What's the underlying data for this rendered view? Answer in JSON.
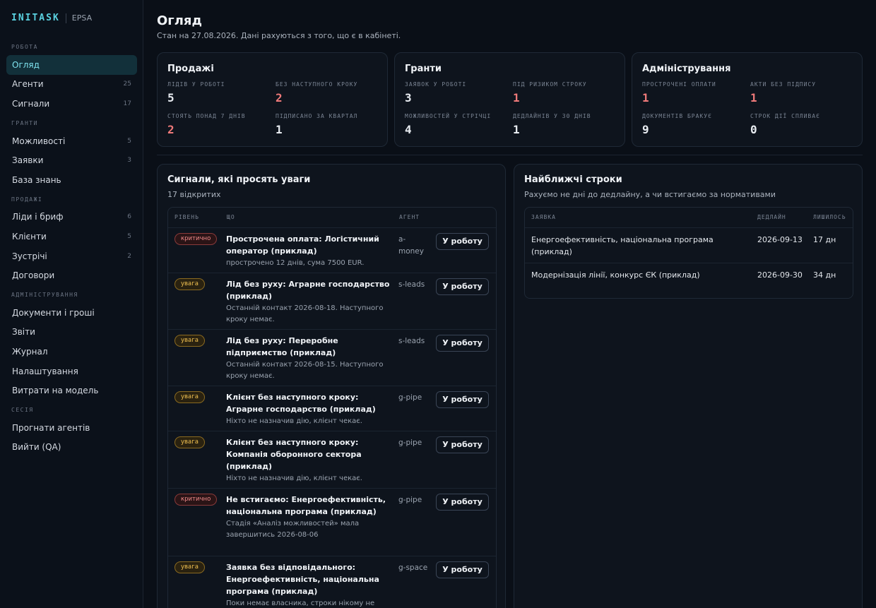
{
  "brand": {
    "logo": "INITASK",
    "sub": "EPSA"
  },
  "nav": {
    "sections": [
      {
        "title": "РОБОТА",
        "items": [
          {
            "label": "Огляд",
            "count": ""
          },
          {
            "label": "Агенти",
            "count": "25"
          },
          {
            "label": "Сигнали",
            "count": "17"
          }
        ]
      },
      {
        "title": "ГРАНТИ",
        "items": [
          {
            "label": "Можливості",
            "count": "5"
          },
          {
            "label": "Заявки",
            "count": "3"
          },
          {
            "label": "База знань",
            "count": ""
          }
        ]
      },
      {
        "title": "ПРОДАЖІ",
        "items": [
          {
            "label": "Ліди і бриф",
            "count": "6"
          },
          {
            "label": "Клієнти",
            "count": "5"
          },
          {
            "label": "Зустрічі",
            "count": "2"
          },
          {
            "label": "Договори",
            "count": ""
          }
        ]
      },
      {
        "title": "АДМІНІСТРУВАННЯ",
        "items": [
          {
            "label": "Документи і гроші",
            "count": ""
          },
          {
            "label": "Звіти",
            "count": ""
          },
          {
            "label": "Журнал",
            "count": ""
          },
          {
            "label": "Налаштування",
            "count": ""
          },
          {
            "label": "Витрати на модель",
            "count": ""
          }
        ]
      },
      {
        "title": "СЕСІЯ",
        "items": [
          {
            "label": "Прогнати агентів",
            "count": ""
          },
          {
            "label": "Вийти (QA)",
            "count": ""
          }
        ]
      }
    ]
  },
  "page": {
    "title": "Огляд",
    "subtitle": "Стан на 27.08.2026. Дані рахуються з того, що є в кабінеті."
  },
  "summary": {
    "sales": {
      "title": "Продажі",
      "stats": [
        {
          "label": "ЛІДІВ У РОБОТІ",
          "value": "5",
          "alert": false
        },
        {
          "label": "БЕЗ НАСТУПНОГО КРОКУ",
          "value": "2",
          "alert": true
        },
        {
          "label": "СТОЯТЬ ПОНАД 7 ДНІВ",
          "value": "2",
          "alert": true
        },
        {
          "label": "ПІДПИСАНО ЗА КВАРТАЛ",
          "value": "1",
          "alert": false
        }
      ]
    },
    "grants": {
      "title": "Гранти",
      "stats": [
        {
          "label": "ЗАЯВОК У РОБОТІ",
          "value": "3",
          "alert": false
        },
        {
          "label": "ПІД РИЗИКОМ СТРОКУ",
          "value": "1",
          "alert": true
        },
        {
          "label": "МОЖЛИВОСТЕЙ У СТРІЧЦІ",
          "value": "4",
          "alert": false
        },
        {
          "label": "ДЕДЛАЙНІВ У 30 ДНІВ",
          "value": "1",
          "alert": false
        }
      ]
    },
    "admin": {
      "title": "Адміністрування",
      "stats": [
        {
          "label": "ПРОСТРОЧЕНІ ОПЛАТИ",
          "value": "1",
          "alert": true
        },
        {
          "label": "АКТИ БЕЗ ПІДПИСУ",
          "value": "1",
          "alert": true
        },
        {
          "label": "ДОКУМЕНТІВ БРАКУЄ",
          "value": "9",
          "alert": false
        },
        {
          "label": "СТРОК ДІЇ СПЛИВАЄ",
          "value": "0",
          "alert": false
        }
      ]
    }
  },
  "signals": {
    "title": "Сигнали, які просять уваги",
    "subtitle": "17 відкритих",
    "columns": {
      "level": "РІВЕНЬ",
      "what": "ЩО",
      "agent": "АГЕНТ"
    },
    "action_label": "У роботу",
    "rows": [
      {
        "level": "критично",
        "severity": "crit",
        "title": "Прострочена оплата: Логістичний оператор (приклад)",
        "desc": "прострочено 12 днів, сума 7500 EUR.",
        "agent": "a-money"
      },
      {
        "level": "увага",
        "severity": "warn",
        "title": "Лід без руху: Аграрне господарство (приклад)",
        "desc": "Останній контакт 2026-08-18. Наступного кроку немає.",
        "agent": "s-leads"
      },
      {
        "level": "увага",
        "severity": "warn",
        "title": "Лід без руху: Переробне підприємство (приклад)",
        "desc": "Останній контакт 2026-08-15. Наступного кроку немає.",
        "agent": "s-leads"
      },
      {
        "level": "увага",
        "severity": "warn",
        "title": "Клієнт без наступного кроку: Аграрне господарство (приклад)",
        "desc": "Ніхто не назначив дію, клієнт чекає.",
        "agent": "g-pipe"
      },
      {
        "level": "увага",
        "severity": "warn",
        "title": "Клієнт без наступного кроку: Компанія оборонного сектора (приклад)",
        "desc": "Ніхто не назначив дію, клієнт чекає.",
        "agent": "g-pipe"
      },
      {
        "level": "критично",
        "severity": "crit",
        "title": "Не встигаємо: Енергоефективність, національна програма (приклад)",
        "desc": "Стадія «Аналіз можливостей» мала завершитись 2026-08-06",
        "agent": "g-pipe"
      },
      {
        "level": "увага",
        "severity": "warn",
        "title": "Заявка без відповідального: Енергоефективність, національна програма (приклад)",
        "desc": "Поки немає власника, строки нікому не",
        "agent": "g-space"
      }
    ]
  },
  "deadlines": {
    "title": "Найближчі строки",
    "subtitle": "Рахуємо не дні до дедлайну, а чи встигаємо за нормативами",
    "columns": {
      "app": "ЗАЯВКА",
      "deadline": "ДЕДЛАЙН",
      "left": "ЛИШИЛОСЬ"
    },
    "rows": [
      {
        "name": "Енергоефективність, національна програма (приклад)",
        "deadline": "2026-09-13",
        "left": "17 дн"
      },
      {
        "name": "Модернізація лінії, конкурс ЄК (приклад)",
        "deadline": "2026-09-30",
        "left": "34 дн"
      }
    ]
  }
}
